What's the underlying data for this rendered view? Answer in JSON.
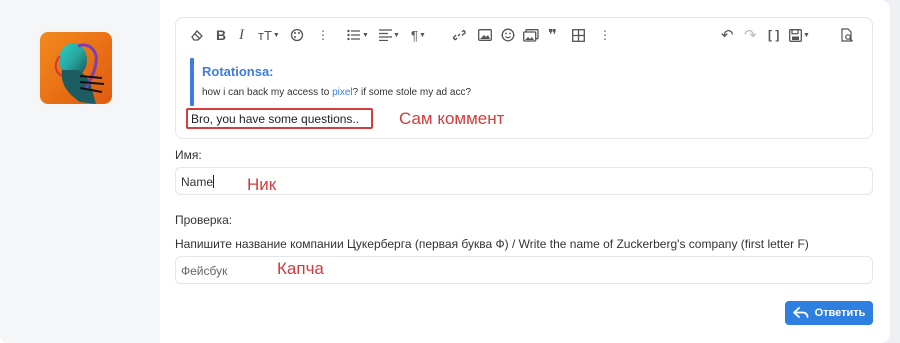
{
  "editor": {
    "quote": {
      "author": "Rotationsa:",
      "text_before": "how i can back my access to ",
      "link": "pixel",
      "text_after": "? if some stole my ad acc?"
    },
    "comment_text": "Bro, you have some questions..",
    "toolbar_icons": [
      "eraser-icon",
      "bold-icon",
      "italic-icon",
      "font-size-icon",
      "palette-icon",
      "more-icon",
      "list-icon",
      "align-icon",
      "paragraph-icon",
      "link-icon",
      "image-icon",
      "smiley-icon",
      "media-icon",
      "quote-icon",
      "table-icon",
      "more-icon",
      "undo-icon",
      "redo-icon",
      "bbcode-icon",
      "drafts-icon",
      "preview-icon"
    ]
  },
  "annotations": {
    "comment": "Сам коммент",
    "nick": "Ник",
    "captcha": "Капча"
  },
  "form": {
    "name_label": "Имя:",
    "name_value": "Name",
    "verification_label": "Проверка:",
    "question": "Напишите название компании Цукерберга (первая буква Ф) / Write the name of Zuckerberg's company (first letter F)",
    "captcha_value": "Фейсбук",
    "submit_label": "Ответить"
  },
  "colors": {
    "accent": "#3e7ce1",
    "annotation": "#d23c3c",
    "button": "#2f7fe0"
  }
}
